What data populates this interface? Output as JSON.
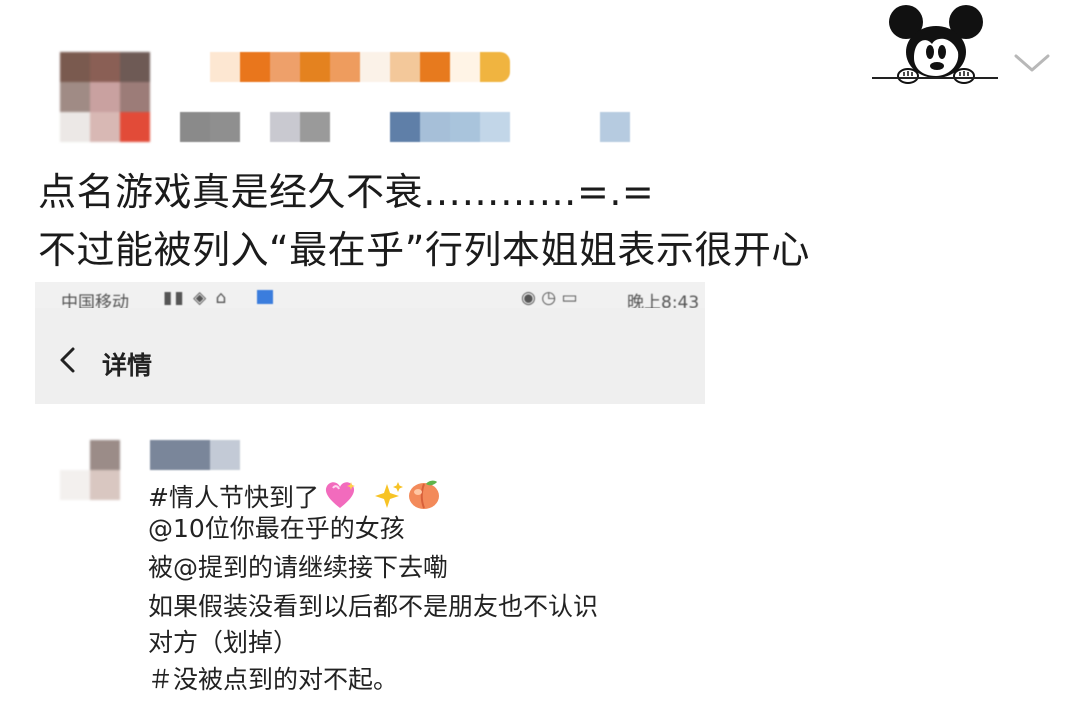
{
  "post": {
    "line1": "点名游戏真是经久不衰…………=.=",
    "line2": "不过能被列入“最在乎”行列本姐姐表示很开心"
  },
  "icons": {
    "profile": "mickey-mouse-avatar-icon",
    "expand": "chevron-down-icon",
    "back": "back-arrow-icon",
    "heart": "sparkling-heart-emoji-icon",
    "sparkles": "sparkles-emoji-icon",
    "peach": "peach-emoji-icon"
  },
  "embedded_screenshot": {
    "status_bar": {
      "carrier": "中国移动",
      "time": "晚上8:43"
    },
    "header": {
      "title": "详情"
    },
    "content": {
      "line1": "#情人节快到了",
      "line2": "@10位你最在乎的女孩",
      "line3": "被@提到的请继续接下去嘞",
      "line4": "如果假装没看到以后都不是朋友也不认识",
      "line5": "对方（划掉）",
      "line6": "＃没被点到的对不起。"
    }
  },
  "colors": {
    "blurred_name": [
      "#e9761c",
      "#eea06a",
      "#e48a2e",
      "#f3c89a",
      "#f0b440"
    ],
    "blurred_meta": [
      "#8a8a8a",
      "#c9c9d0",
      "#9aa0ad",
      "#5f7fa8",
      "#a6bfd8"
    ]
  }
}
